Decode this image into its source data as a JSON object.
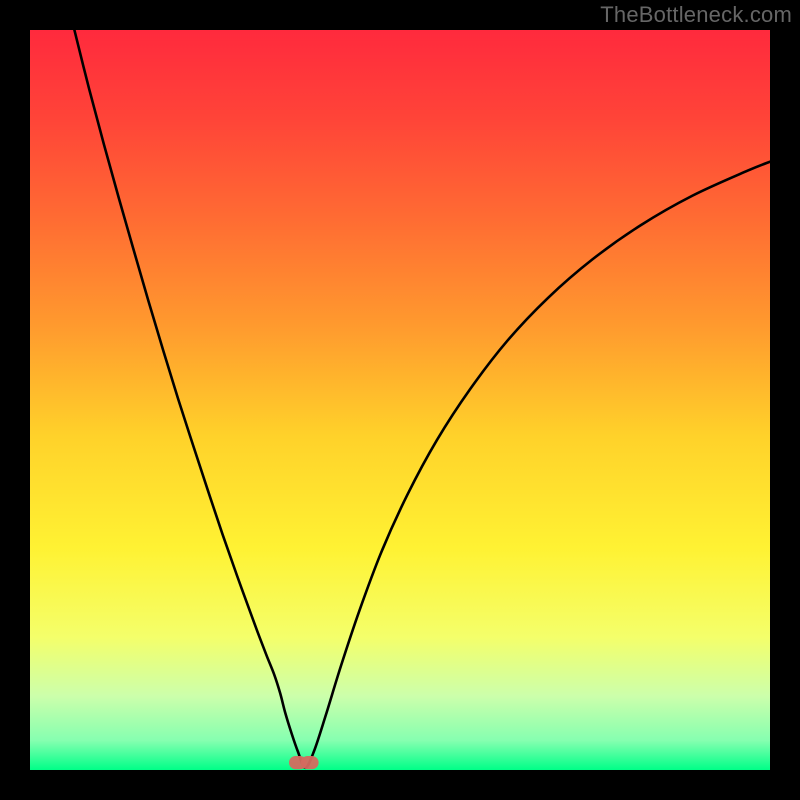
{
  "watermark": "TheBottleneck.com",
  "chart_data": {
    "type": "line",
    "title": "",
    "xlabel": "",
    "ylabel": "",
    "xlim": [
      0,
      100
    ],
    "ylim": [
      0,
      100
    ],
    "background_gradient": {
      "stops": [
        {
          "pos": 0.0,
          "color": "#ff2a3d"
        },
        {
          "pos": 0.12,
          "color": "#ff4438"
        },
        {
          "pos": 0.25,
          "color": "#ff6a33"
        },
        {
          "pos": 0.4,
          "color": "#ff9a2e"
        },
        {
          "pos": 0.55,
          "color": "#ffd22a"
        },
        {
          "pos": 0.7,
          "color": "#fff233"
        },
        {
          "pos": 0.82,
          "color": "#f4ff6a"
        },
        {
          "pos": 0.9,
          "color": "#ccffab"
        },
        {
          "pos": 0.96,
          "color": "#86ffb0"
        },
        {
          "pos": 1.0,
          "color": "#00ff88"
        }
      ]
    },
    "series": [
      {
        "name": "bottleneck-curve",
        "color": "#000000",
        "x": [
          6,
          8,
          10,
          12,
          14,
          16,
          18,
          20,
          22,
          24,
          26,
          28,
          30,
          31,
          32,
          33,
          33.8,
          34.5,
          35.3,
          36.2,
          37.2,
          38.4,
          40.0,
          42.0,
          44.5,
          47.5,
          51.0,
          55.0,
          59.5,
          64.5,
          70.0,
          76.0,
          82.5,
          89.5,
          97.0,
          100.0
        ],
        "y": [
          100,
          92,
          84.5,
          77.3,
          70.3,
          63.4,
          56.7,
          50.2,
          44.0,
          37.9,
          31.9,
          26.2,
          20.7,
          18.0,
          15.4,
          12.9,
          10.4,
          7.7,
          5.1,
          2.5,
          0.3,
          2.6,
          7.5,
          14.0,
          21.5,
          29.5,
          37.2,
          44.6,
          51.5,
          58.0,
          63.8,
          69.0,
          73.6,
          77.6,
          81.0,
          82.2
        ]
      }
    ],
    "markers": [
      {
        "name": "optimum-marker-a",
        "x": 36.2,
        "y": 1.0
      },
      {
        "name": "optimum-marker-b",
        "x": 37.8,
        "y": 1.0
      }
    ]
  }
}
